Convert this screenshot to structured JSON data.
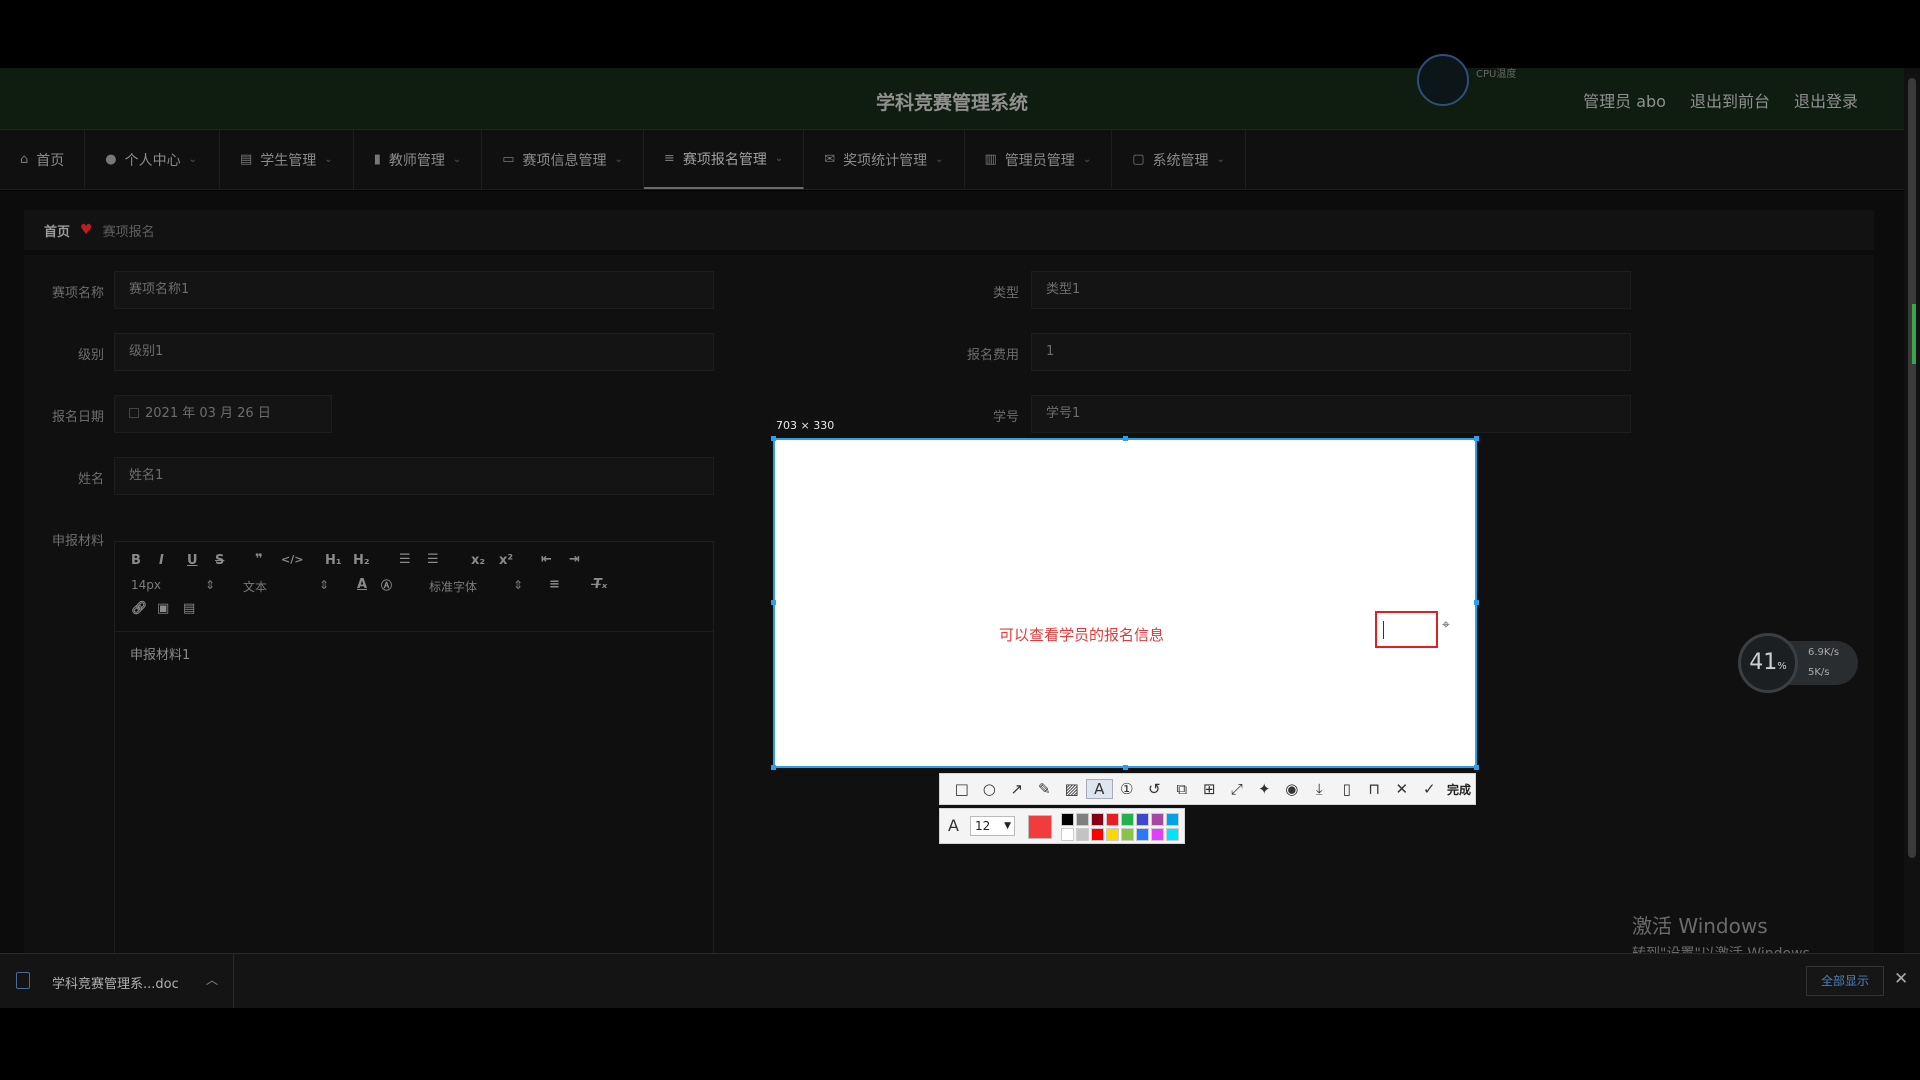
{
  "header": {
    "title": "学科竞赛管理系统",
    "cpu_label": "CPU温度",
    "user": "管理员 abo",
    "to_front": "退出到前台",
    "logout": "退出登录"
  },
  "nav": {
    "items": [
      {
        "label": "首页",
        "icon": "home-icon"
      },
      {
        "label": "个人中心",
        "icon": "user-icon"
      },
      {
        "label": "学生管理",
        "icon": "list-icon"
      },
      {
        "label": "教师管理",
        "icon": "bar-chart-icon"
      },
      {
        "label": "赛项信息管理",
        "icon": "monitor-icon"
      },
      {
        "label": "赛项报名管理",
        "icon": "menu-icon",
        "active": true
      },
      {
        "label": "奖项统计管理",
        "icon": "mail-icon"
      },
      {
        "label": "管理员管理",
        "icon": "chart-icon"
      },
      {
        "label": "系统管理",
        "icon": "message-icon"
      }
    ]
  },
  "breadcrumb": {
    "home": "首页",
    "current": "赛项报名"
  },
  "form": {
    "event_name_label": "赛项名称",
    "event_name_value": "赛项名称1",
    "type_label": "类型",
    "type_value": "类型1",
    "level_label": "级别",
    "level_value": "级别1",
    "fee_label": "报名费用",
    "fee_value": "1",
    "date_label": "报名日期",
    "date_value": "2021 年 03 月 26 日",
    "student_no_label": "学号",
    "student_no_value": "学号1",
    "name_label": "姓名",
    "name_value": "姓名1",
    "material_label": "申报材料"
  },
  "editor": {
    "font_size": "14px",
    "format": "文本",
    "font_family": "标准字体",
    "content": "申报材料1"
  },
  "screenshot_tool": {
    "size_label": "703 × 330",
    "annotation": "可以查看学员的报名信息",
    "done_label": "完成",
    "font_size_value": "12",
    "current_color": "#f23c3c",
    "palette": [
      "#000000",
      "#7f7f7f",
      "#880015",
      "#ed1c24",
      "#22b14c",
      "#3f48cc",
      "#a349a4",
      "#00a2e8",
      "#ffffff",
      "#c3c3c3",
      "#ff0000",
      "#ffd700",
      "#8bc34a",
      "#2979ff",
      "#e040fb",
      "#00e5ff"
    ]
  },
  "net_meter": {
    "percent": "41",
    "percent_unit": "%",
    "up": "6.9K/s",
    "down": "5K/s"
  },
  "watermark": {
    "line1": "激活 Windows",
    "line2": "转到\"设置\"以激活 Windows。"
  },
  "downloads": {
    "file": "学科竞赛管理系...doc",
    "show_all": "全部显示"
  }
}
